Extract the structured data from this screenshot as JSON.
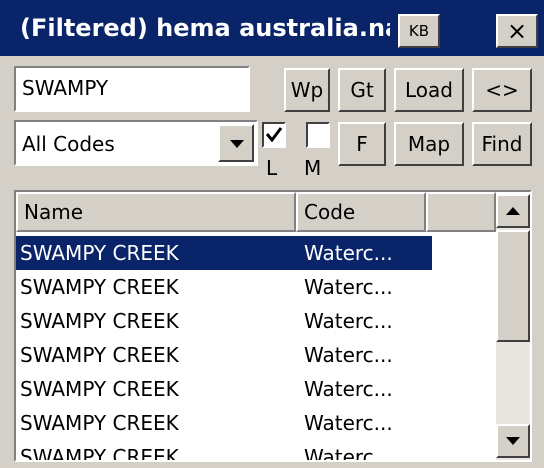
{
  "window": {
    "title": "(Filtered) hema australia.name",
    "kb_label": "KB",
    "close_label": "×"
  },
  "search": {
    "value": "SWAMPY"
  },
  "buttons": {
    "wp": "Wp",
    "gt": "Gt",
    "load": "Load",
    "swap": "<>",
    "f": "F",
    "map": "Map",
    "find": "Find"
  },
  "filter": {
    "selected": "All Codes"
  },
  "checkboxes": {
    "l_label": "L",
    "m_label": "M",
    "l_checked": true,
    "m_checked": false
  },
  "list": {
    "columns": [
      "Name",
      "Code"
    ],
    "rows": [
      {
        "name": "SWAMPY CREEK",
        "code": "Waterc..."
      },
      {
        "name": "SWAMPY CREEK",
        "code": "Waterc..."
      },
      {
        "name": "SWAMPY CREEK",
        "code": "Waterc..."
      },
      {
        "name": "SWAMPY CREEK",
        "code": "Waterc..."
      },
      {
        "name": "SWAMPY CREEK",
        "code": "Waterc..."
      },
      {
        "name": "SWAMPY CREEK",
        "code": "Waterc..."
      },
      {
        "name": "SWAMPY CREEK",
        "code": "Waterc..."
      }
    ]
  },
  "colors": {
    "titlebar": "#0a246a",
    "face": "#d4d0c8",
    "selection": "#0a246a"
  }
}
